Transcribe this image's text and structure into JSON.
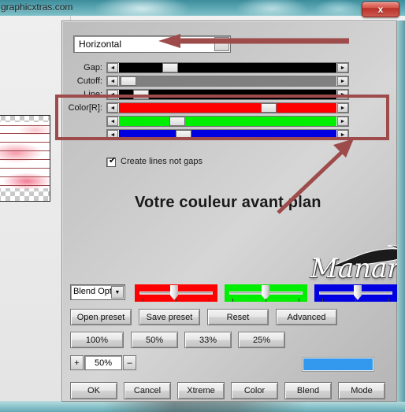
{
  "browser": {
    "site_text": "graphicxtras.com"
  },
  "window": {
    "close_label": "x"
  },
  "dialog": {
    "orientation": {
      "value": "Horizontal",
      "dropdown_icon": "chevron-down-icon"
    },
    "sliders": [
      {
        "label": "Gap:",
        "value": "10",
        "track_color": "#000000",
        "thumb_pct": 22,
        "arrow_left": "◄",
        "arrow_right": "►"
      },
      {
        "label": "Cutoff:",
        "value": "-1",
        "track_color": "#808080",
        "thumb_pct": 1,
        "arrow_left": "◄",
        "arrow_right": "►"
      },
      {
        "label": "Line:",
        "value": "10",
        "track_color": "#000000",
        "thumb_pct": 7,
        "arrow_left": "◄",
        "arrow_right": "►"
      },
      {
        "label": "Color[R]:",
        "value": "171",
        "track_color": "#ff0000",
        "thumb_pct": 66,
        "arrow_left": "◄",
        "arrow_right": "►"
      },
      {
        "label": "",
        "value": "63",
        "track_color": "#00ee00",
        "thumb_pct": 24,
        "arrow_left": "◄",
        "arrow_right": "►"
      },
      {
        "label": "",
        "value": "69",
        "track_color": "#0000e0",
        "thumb_pct": 27,
        "arrow_left": "◄",
        "arrow_right": "►"
      }
    ],
    "checkbox": {
      "label": "Create lines not gaps",
      "checked": true,
      "tick_glyph": "✔"
    },
    "annotation_text": "Votre couleur avant plan",
    "signature": "Manany",
    "blend_combo": {
      "value": "Blend Opti",
      "dropdown_icon": "chevron-down-icon"
    },
    "trackbars": [
      {
        "name": "red",
        "color": "#ff0000",
        "thumb_pct": 45
      },
      {
        "name": "green",
        "color": "#00ee00",
        "thumb_pct": 47
      },
      {
        "name": "blue",
        "color": "#0000e0",
        "thumb_pct": 50
      }
    ],
    "preset_buttons": [
      {
        "label": "Open preset"
      },
      {
        "label": "Save preset"
      },
      {
        "label": "Reset"
      },
      {
        "label": "Advanced"
      }
    ],
    "zoom_buttons": [
      {
        "label": "100%"
      },
      {
        "label": "50%"
      },
      {
        "label": "33%"
      },
      {
        "label": "25%"
      }
    ],
    "stepper": {
      "plus": "+",
      "value": "50%",
      "minus": "–"
    },
    "color_swatch": "#3399ee",
    "action_buttons": [
      {
        "label": "OK"
      },
      {
        "label": "Cancel"
      },
      {
        "label": "Xtreme"
      },
      {
        "label": "Color"
      },
      {
        "label": "Blend"
      },
      {
        "label": "Mode"
      }
    ]
  },
  "annotations": {
    "highlight_color": "#9e4b4b",
    "horizontal_arrow": "arrow-left",
    "diagonal_arrow": "arrow-up-right"
  }
}
